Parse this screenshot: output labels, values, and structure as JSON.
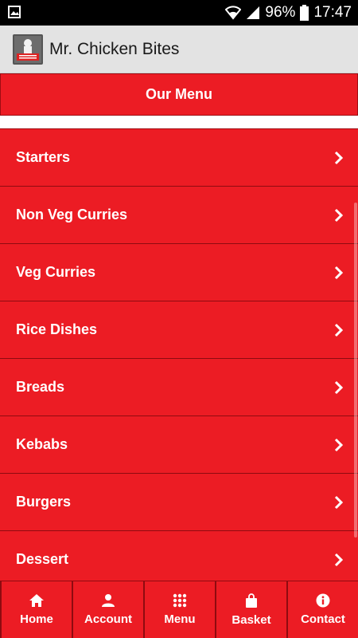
{
  "status_bar": {
    "battery_percent": "96%",
    "time": "17:47"
  },
  "app_bar": {
    "title": "Mr. Chicken Bites",
    "logo_text": "Mr. Chicken Bites"
  },
  "menu": {
    "header": "Our Menu",
    "items": [
      {
        "label": "Starters"
      },
      {
        "label": "Non Veg Curries"
      },
      {
        "label": "Veg Curries"
      },
      {
        "label": "Rice Dishes"
      },
      {
        "label": "Breads"
      },
      {
        "label": "Kebabs"
      },
      {
        "label": "Burgers"
      },
      {
        "label": "Dessert"
      }
    ]
  },
  "bottom_nav": {
    "items": [
      {
        "label": "Home",
        "icon": "home-icon"
      },
      {
        "label": "Account",
        "icon": "user-icon"
      },
      {
        "label": "Menu",
        "icon": "grid-icon"
      },
      {
        "label": "Basket",
        "icon": "basket-icon"
      },
      {
        "label": "Contact",
        "icon": "info-icon"
      }
    ]
  },
  "colors": {
    "primary_red": "#ec1c24",
    "divider": "#8f0b10",
    "app_bar_bg": "#e3e3e3"
  }
}
